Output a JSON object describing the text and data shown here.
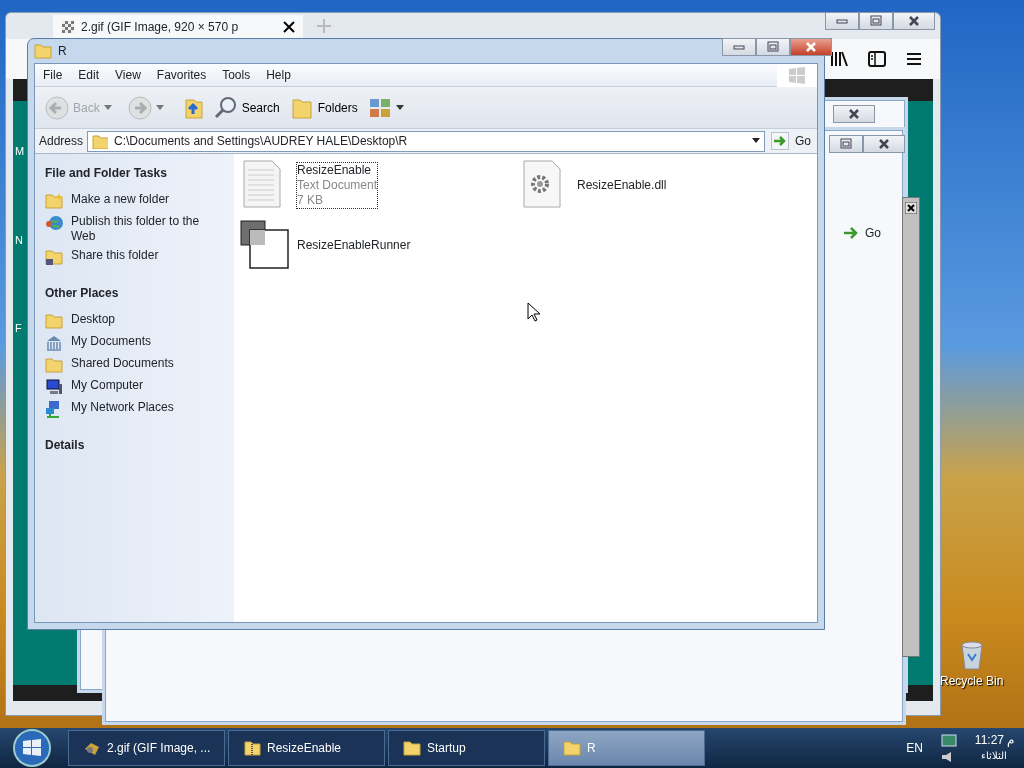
{
  "browser": {
    "tab_title": "2.gif (GIF Image, 920 × 570 p",
    "page_letters": [
      "M",
      "N",
      "F"
    ]
  },
  "background_window": {
    "go": "Go"
  },
  "window": {
    "title": "R"
  },
  "menu": [
    "File",
    "Edit",
    "View",
    "Favorites",
    "Tools",
    "Help"
  ],
  "toolbar": [
    {
      "kind": "back",
      "label": "Back",
      "disabled": true
    },
    {
      "kind": "forward",
      "disabled": true
    },
    {
      "kind": "up",
      "disabled": false
    },
    {
      "kind": "search",
      "label": "Search",
      "disabled": false
    },
    {
      "kind": "folders",
      "label": "Folders",
      "disabled": false
    },
    {
      "kind": "views",
      "disabled": false
    }
  ],
  "address": {
    "label": "Address",
    "value": "C:\\Documents and Settings\\AUDREY HALE\\Desktop\\R",
    "go": "Go"
  },
  "sidebar": [
    {
      "title": "File and Folder Tasks",
      "items": [
        {
          "label": "Make a new folder"
        },
        {
          "label": "Publish this folder to the Web"
        },
        {
          "label": "Share this folder"
        }
      ]
    },
    {
      "title": "Other Places",
      "items": [
        {
          "label": "Desktop"
        },
        {
          "label": "My Documents"
        },
        {
          "label": "Shared Documents"
        },
        {
          "label": "My Computer"
        },
        {
          "label": "My Network Places"
        }
      ]
    },
    {
      "title": "Details"
    }
  ],
  "files": [
    {
      "kind": "text",
      "name": "ResizeEnable",
      "type": "Text Document",
      "size": "7 KB",
      "selected": true
    },
    {
      "kind": "dll",
      "name": "ResizeEnable.dll",
      "selected": false
    },
    {
      "kind": "app",
      "name": "ResizeEnableRunner",
      "selected": false
    }
  ],
  "desktop": {
    "recycle_bin": "Recycle Bin"
  },
  "taskbar": {
    "items": [
      {
        "label": "2.gif (GIF Image, ...",
        "selected": false
      },
      {
        "label": "ResizeEnable",
        "selected": false
      },
      {
        "label": "Startup",
        "selected": false
      },
      {
        "label": "R",
        "selected": true
      }
    ],
    "language": "EN",
    "time": "11:27",
    "period": "م",
    "day": "الثلاثاء"
  }
}
